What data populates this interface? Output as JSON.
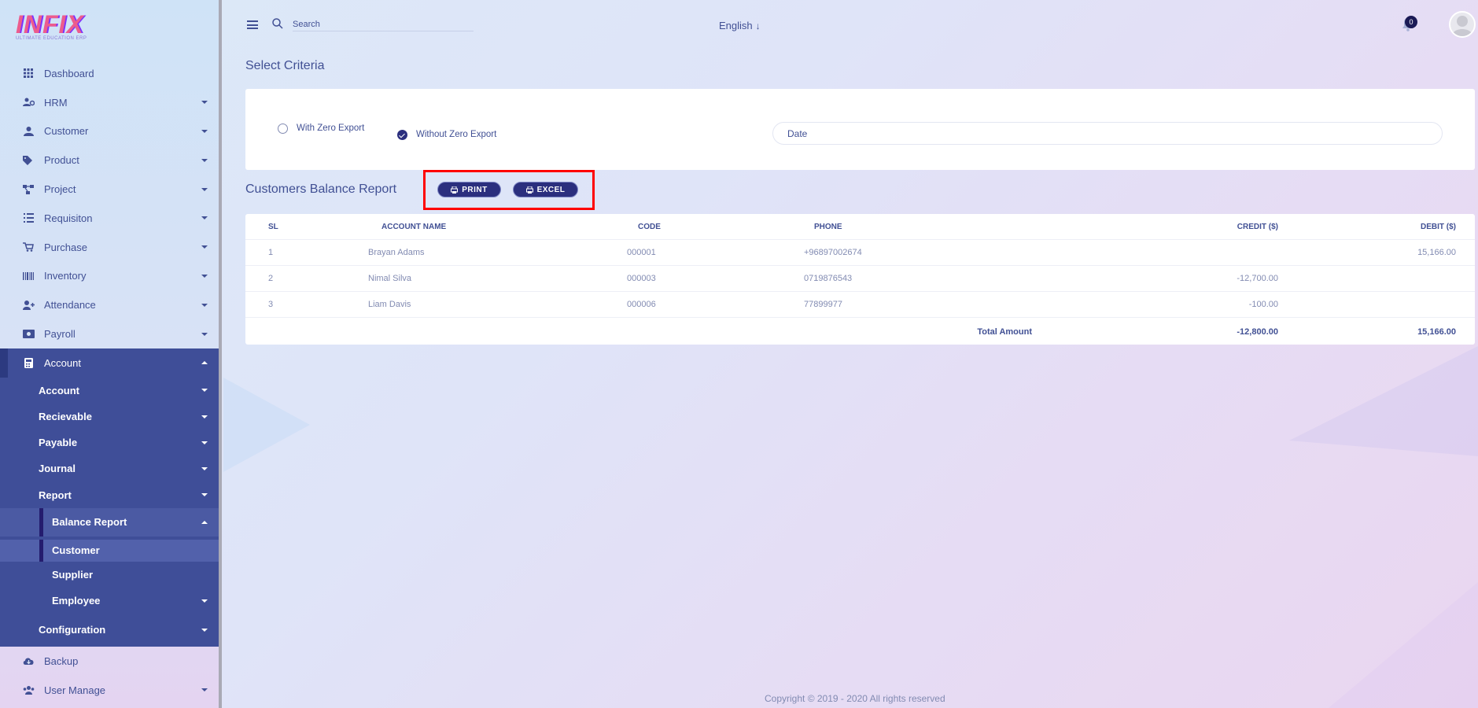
{
  "app": {
    "logo_text": "INFIX",
    "logo_subtitle": "ULTIMATE EDUCATION ERP"
  },
  "header": {
    "search_placeholder": "Search",
    "language": "English",
    "notification_count": "0"
  },
  "sidebar": {
    "items": [
      {
        "label": "Dashboard",
        "icon": "grid-icon"
      },
      {
        "label": "HRM",
        "icon": "users-cog-icon"
      },
      {
        "label": "Customer",
        "icon": "user-icon"
      },
      {
        "label": "Product",
        "icon": "tags-icon"
      },
      {
        "label": "Project",
        "icon": "project-diagram-icon"
      },
      {
        "label": "Requisiton",
        "icon": "list-icon"
      },
      {
        "label": "Purchase",
        "icon": "cart-icon"
      },
      {
        "label": "Inventory",
        "icon": "barcode-icon"
      },
      {
        "label": "Attendance",
        "icon": "user-plus-icon"
      },
      {
        "label": "Payroll",
        "icon": "money-icon"
      },
      {
        "label": "Account",
        "icon": "calculator-icon"
      }
    ],
    "account_sub": [
      "Account",
      "Recievable",
      "Payable",
      "Journal",
      "Report"
    ],
    "report_sub": {
      "balance_report": "Balance Report",
      "customer": "Customer",
      "supplier": "Supplier",
      "employee": "Employee"
    },
    "configuration": "Configuration",
    "bottom_items": [
      {
        "label": "Backup",
        "icon": "cloud-download-icon"
      },
      {
        "label": "User Manage",
        "icon": "users-icon"
      }
    ]
  },
  "criteria": {
    "title": "Select Criteria",
    "option_with_zero": "With Zero Export",
    "option_without_zero": "Without Zero Export",
    "selected": "Without Zero Export",
    "date_placeholder": "Date"
  },
  "report": {
    "title": "Customers Balance Report",
    "print_label": "PRINT",
    "excel_label": "EXCEL",
    "columns": [
      "SL",
      "ACCOUNT NAME",
      "CODE",
      "PHONE",
      "CREDIT ($)",
      "DEBIT ($)"
    ],
    "rows": [
      {
        "sl": "1",
        "account_name": "Brayan Adams",
        "code": "000001",
        "phone": "+96897002674",
        "credit": "",
        "debit": "15,166.00"
      },
      {
        "sl": "2",
        "account_name": "Nimal Silva",
        "code": "000003",
        "phone": "0719876543",
        "credit": "-12,700.00",
        "debit": ""
      },
      {
        "sl": "3",
        "account_name": "Liam Davis",
        "code": "000006",
        "phone": "77899977",
        "credit": "-100.00",
        "debit": ""
      }
    ],
    "total_label": "Total Amount",
    "total_credit": "-12,800.00",
    "total_debit": "15,166.00"
  },
  "footer": {
    "copyright": "Copyright © 2019 - 2020 All rights reserved"
  },
  "colors": {
    "primary": "#415094",
    "sidebar_active": "#3f4e98",
    "button": "#2b2f7e",
    "highlight": "#ff0000"
  }
}
